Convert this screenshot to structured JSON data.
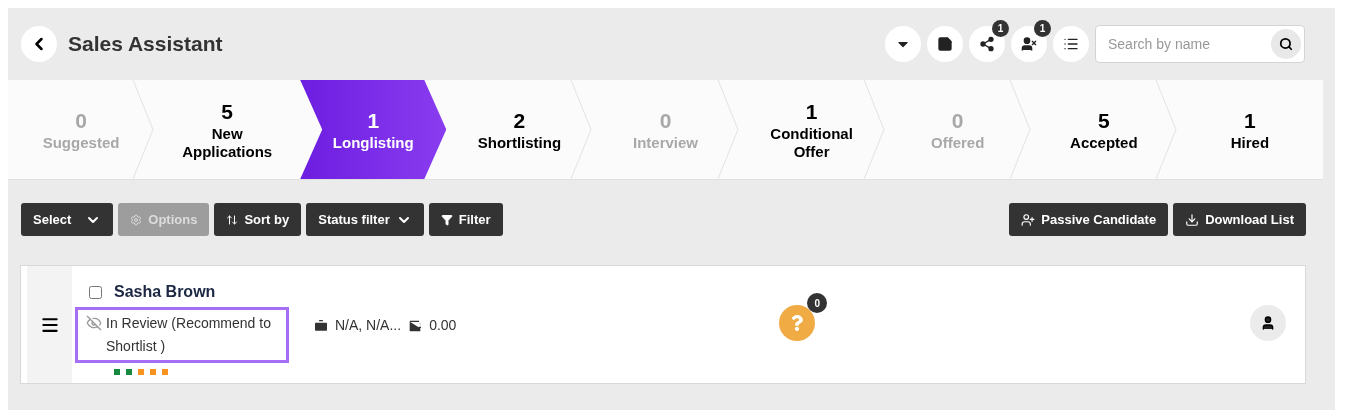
{
  "header": {
    "title": "Sales Assistant",
    "icon_buttons": [
      {
        "kind": "caret"
      },
      {
        "kind": "note"
      },
      {
        "kind": "share",
        "badge": "1"
      },
      {
        "kind": "user-off",
        "badge": "1"
      },
      {
        "kind": "list"
      }
    ],
    "search": {
      "placeholder": "Search by name"
    }
  },
  "stages": [
    {
      "count": "0",
      "label": "Suggested",
      "selected": false,
      "muted": true
    },
    {
      "count": "5",
      "label": "New Applications",
      "selected": false,
      "muted": false
    },
    {
      "count": "1",
      "label": "Longlisting",
      "selected": true,
      "muted": false
    },
    {
      "count": "2",
      "label": "Shortlisting",
      "selected": false,
      "muted": false
    },
    {
      "count": "0",
      "label": "Interview",
      "selected": false,
      "muted": true
    },
    {
      "count": "1",
      "label": "Conditional Offer",
      "selected": false,
      "muted": false
    },
    {
      "count": "0",
      "label": "Offered",
      "selected": false,
      "muted": true
    },
    {
      "count": "5",
      "label": "Accepted",
      "selected": false,
      "muted": false
    },
    {
      "count": "1",
      "label": "Hired",
      "selected": false,
      "muted": false
    }
  ],
  "toolbar": {
    "left": [
      {
        "kind": "select",
        "label": "Select",
        "disabled": false
      },
      {
        "kind": "options",
        "label": "Options",
        "disabled": true
      },
      {
        "kind": "sort",
        "label": "Sort by",
        "disabled": false
      },
      {
        "kind": "status",
        "label": "Status filter",
        "disabled": false
      },
      {
        "kind": "filter",
        "label": "Filter",
        "disabled": false
      }
    ],
    "right": [
      {
        "kind": "passive",
        "label": "Passive Candidate",
        "disabled": false
      },
      {
        "kind": "download",
        "label": "Download List",
        "disabled": false
      }
    ]
  },
  "candidates": [
    {
      "name": "Sasha Brown",
      "checked": false,
      "status": "In Review (Recommend to Shortlist )",
      "hidden": true,
      "location": "N/A, N/A...",
      "amount": "0.00",
      "question_badge": "0",
      "steps": [
        {
          "color": "#16893f"
        },
        {
          "color": "#16893f"
        },
        {
          "color": "#f7931e"
        },
        {
          "color": "#f7931e"
        },
        {
          "color": "#f7931e"
        }
      ]
    }
  ]
}
